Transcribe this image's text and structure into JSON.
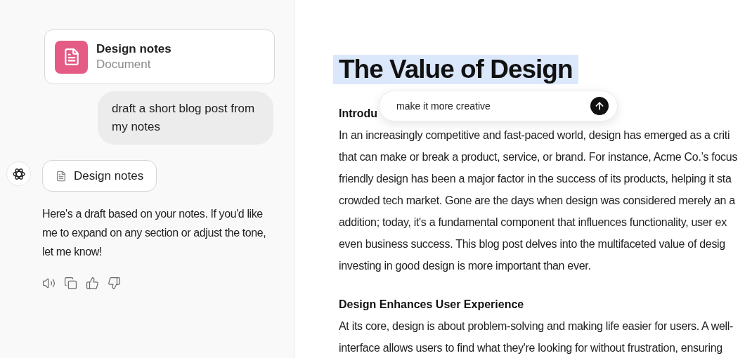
{
  "chat": {
    "attachment": {
      "title": "Design notes",
      "subtitle": "Document"
    },
    "messages": [
      {
        "kind": "user",
        "text": "draft a short blog post from my notes"
      },
      {
        "kind": "assistant",
        "file": "Design notes",
        "text": "Here's a draft based on your notes. If you'd like me to expand on any section or adjust the tone, let me know!"
      }
    ]
  },
  "document": {
    "title": {
      "text": "The Value of Design",
      "selected": true
    },
    "sections": [
      {
        "heading": "Introdu",
        "lines": [
          "In an increasingly competitive and fast-paced world, design has emerged as a criti",
          "that can make or break a product, service, or brand. For instance, Acme Co.’s focus",
          "friendly design has been a major factor in the success of its products, helping it sta",
          "crowded tech market. Gone are the days when design was considered merely an a",
          "addition; today, it's a fundamental component that influences functionality, user ex",
          "even business success. This blog post delves into the multifaceted value of desig",
          "investing in good design is more important than ever."
        ]
      },
      {
        "heading": "Design Enhances User Experience",
        "lines": [
          "At its core, design is about problem-solving and making life easier for users. A well-",
          "interface allows users to find what they're looking for without frustration, ensuring"
        ]
      }
    ]
  },
  "edit_prompt": {
    "value": "make it more creative"
  }
}
